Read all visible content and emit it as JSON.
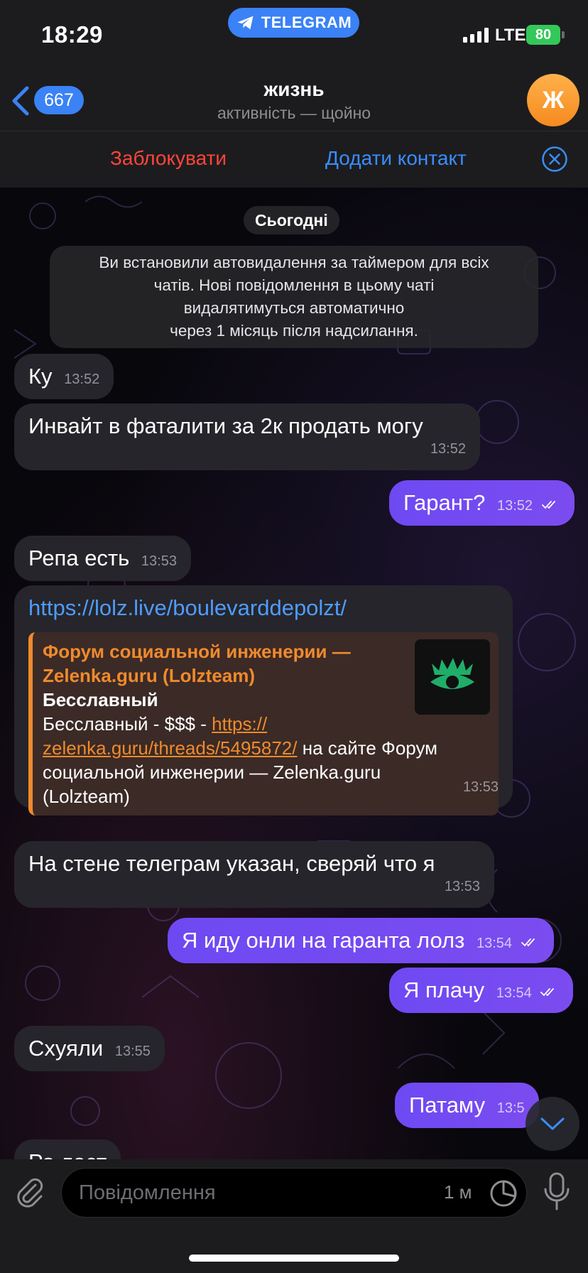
{
  "status_bar": {
    "time": "18:29",
    "app_pill": "TELEGRAM",
    "network": "LTE",
    "battery": "80"
  },
  "header": {
    "back_count": "667",
    "title": "жизнь",
    "subtitle": "активність — щойно",
    "avatar_letter": "Ж",
    "avatar_color": "#f7a03a"
  },
  "action_bar": {
    "block_label": "Заблокувати",
    "add_contact_label": "Додати контакт"
  },
  "chat": {
    "date_label": "Сьогодні",
    "service_message": [
      "Ви встановили автовидалення за таймером для всіх",
      "чатів. Нові повідомлення в цьому чаті",
      "видалятимуться автоматично",
      "через 1 місяць після надсилання."
    ],
    "messages": [
      {
        "dir": "in",
        "text": "Ку",
        "time": "13:52"
      },
      {
        "dir": "in",
        "text": "Инвайт в фаталити за 2к продать могу",
        "time": "13:52"
      },
      {
        "dir": "out",
        "text": "Гарант?",
        "time": "13:52"
      },
      {
        "dir": "in",
        "text": "Репа есть",
        "time": "13:53"
      },
      {
        "dir": "in",
        "link": "https://lolz.live/boulevarddepolzt/",
        "preview": {
          "site_line1": "Форум социальной инженерии —",
          "site_line2": "Zelenka.guru (Lolzteam)",
          "title": "Бесславный",
          "desc_prefix": "Бесславный - $$$ - ",
          "desc_link1": "https://",
          "desc_link2": "zelenka.guru/threads/5495872/",
          "desc_suffix": " на сайте Форум",
          "desc_line3": "социальной инженерии —  Zelenka.guru",
          "desc_line4": "(Lolzteam)"
        },
        "time": "13:53"
      },
      {
        "dir": "in",
        "text": "На стене телеграм указан, сверяй что я",
        "time": "13:53"
      },
      {
        "dir": "out",
        "text": "Я иду онли на гаранта лолз",
        "time": "13:54"
      },
      {
        "dir": "out",
        "text": "Я плачу",
        "time": "13:54"
      },
      {
        "dir": "in",
        "text": "Схуяли",
        "time": "13:55"
      },
      {
        "dir": "out",
        "text": "Патаму",
        "time": "13:5"
      },
      {
        "dir": "in",
        "text": "Ро ласт",
        "time": ""
      }
    ]
  },
  "input": {
    "placeholder": "Повідомлення",
    "timer_label": "1 м"
  },
  "colors": {
    "accent": "#3a82f6",
    "outgoing_bubble": "#7048f1",
    "incoming_bubble": "#26252b",
    "danger": "#ff453a",
    "link_preview_accent": "#f08a2c"
  }
}
